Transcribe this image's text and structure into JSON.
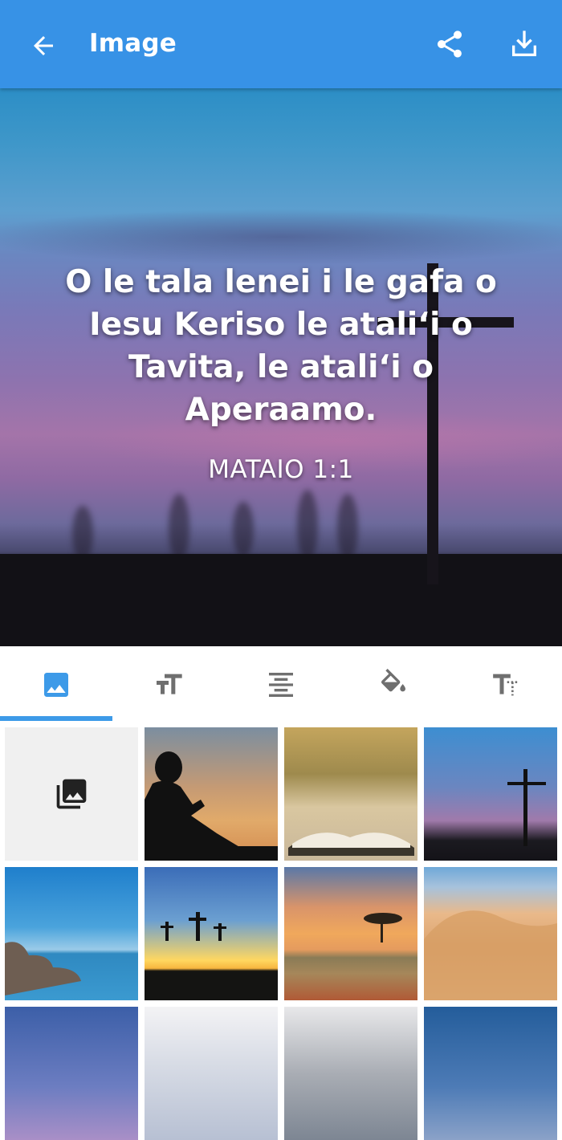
{
  "app_bar": {
    "title": "Image",
    "back_icon": "arrow-back-icon",
    "share_icon": "share-icon",
    "download_icon": "download-icon",
    "background_color": "#3792e6"
  },
  "preview": {
    "verse_text": "O le tala lenei i le gafa o Iesu Keriso le atali‘i o Tavita, le atali‘i o Aperaamo.",
    "reference": "MATAIO 1:1"
  },
  "tabs": [
    {
      "name": "background",
      "icon": "image-icon",
      "selected": true
    },
    {
      "name": "font-size",
      "icon": "text-size-icon",
      "selected": false
    },
    {
      "name": "alignment",
      "icon": "align-center-icon",
      "selected": false
    },
    {
      "name": "color",
      "icon": "paint-bucket-icon",
      "selected": false
    },
    {
      "name": "font-style",
      "icon": "text-format-icon",
      "selected": false
    }
  ],
  "accent_color": "#3d9ae8",
  "gallery": {
    "picker_icon": "photo-library-icon",
    "images": [
      "boy-reading-sunset",
      "open-bible-bokeh",
      "cross-at-dusk",
      "sea-rocks",
      "three-crosses-sunset",
      "tree-savanna-sunset",
      "desert-dunes",
      "purple-sky",
      "cloudy-sky",
      "mountain-clouds",
      "blue-sky"
    ]
  }
}
